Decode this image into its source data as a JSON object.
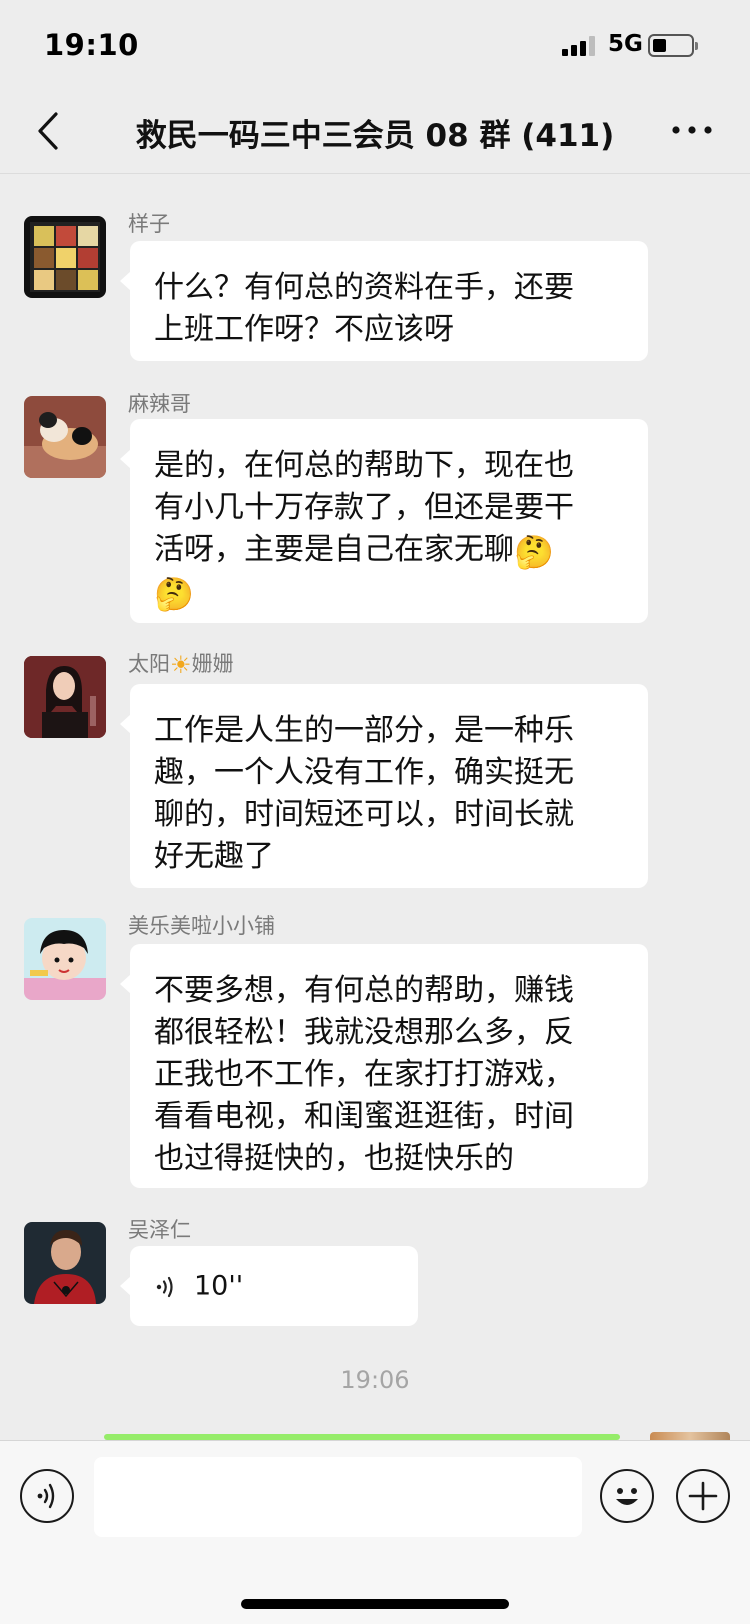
{
  "status_bar": {
    "time": "19:10",
    "network": "5G",
    "battery_level": 0.35
  },
  "nav": {
    "title": "救民一码三中三会员 08 群 (411)",
    "back_icon": "chevron-left-icon",
    "more_icon": "more-horizontal-icon"
  },
  "messages": [
    {
      "sender": "样子",
      "lines": [
        "什么？有何总的资料在手，还要",
        "上班工作呀？不应该呀"
      ]
    },
    {
      "sender": "麻辣哥",
      "lines": [
        "是的，在何总的帮助下，现在也",
        "有小几十万存款了，但还是要干",
        "活呀，主要是自己在家无聊"
      ],
      "emoji": "🤔"
    },
    {
      "sender_prefix": "太阳",
      "sender_suffix": "姗姗",
      "sender_icon": "sun-icon",
      "lines": [
        "工作是人生的一部分，是一种乐",
        "趣，一个人没有工作，确实挺无",
        "聊的，时间短还可以，时间长就",
        "好无趣了"
      ]
    },
    {
      "sender": "美乐美啦小小铺",
      "lines": [
        "不要多想，有何总的帮助，赚钱",
        "都很轻松！我就没想那么多，反",
        "正我也不工作，在家打打游戏，",
        "看看电视，和闺蜜逛逛街，时间",
        "也过得挺快的，也挺快乐的"
      ]
    },
    {
      "sender": "吴泽仁",
      "voice_duration": "10''",
      "voice_icon": "voice-wave-icon"
    }
  ],
  "timestamp": "19:06",
  "input_bar": {
    "voice_icon": "voice-mode-icon",
    "emoji_icon": "smiley-icon",
    "plus_icon": "plus-icon",
    "placeholder": ""
  },
  "colors": {
    "background": "#EDEDED",
    "bubble": "#FFFFFF",
    "sent_bubble": "#95EC69",
    "sender_name": "#7A7A7A",
    "timestamp": "#A5A5A5"
  }
}
